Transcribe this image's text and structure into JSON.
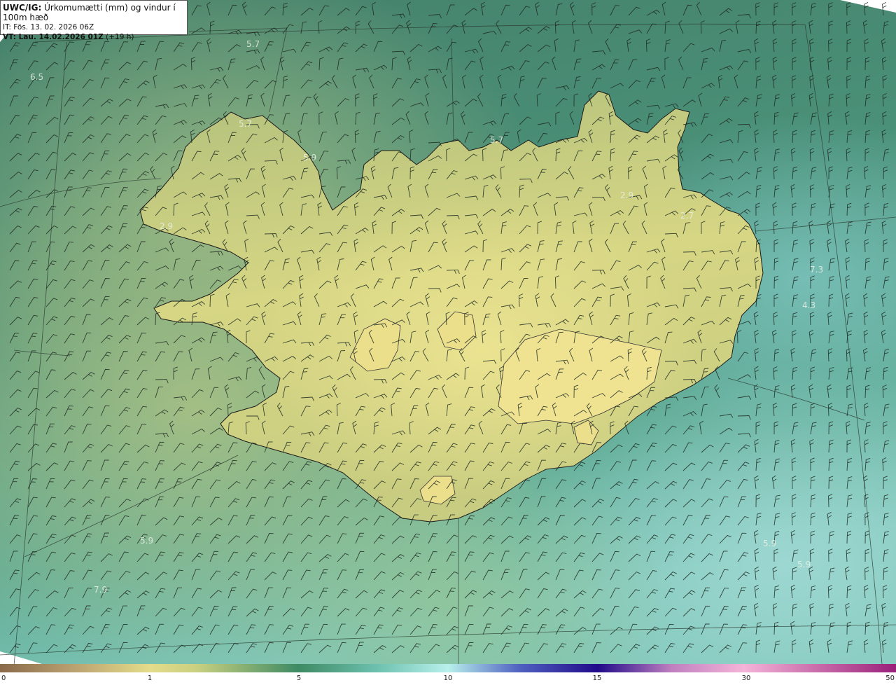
{
  "header": {
    "product": "UWC/IG:",
    "description": " Úrkomumætti (mm) og vindur í 100m hæð",
    "init_time": "IT: Fös. 13. 02. 2026 06Z",
    "valid_prefix": "VT: Lau. 14.02.2026 01Z",
    "valid_suffix": " (+19 h)"
  },
  "map_labels": [
    "5.7",
    "6.5",
    "5.7",
    "5.9",
    "5.7",
    "2.9",
    "2.7",
    "2.9",
    "7.3",
    "4.3",
    "5.9",
    "7.9",
    "5.9",
    "5.9"
  ],
  "colorbar": {
    "ticks": [
      "0",
      "1",
      "5",
      "10",
      "15",
      "30",
      "50"
    ]
  },
  "colors": {
    "land_low": "#c8c878",
    "land_high": "#e6e08c",
    "sea_green": "#4e8a6a",
    "sea_teal": "#6cb8a8",
    "coast": "#1a1a1a"
  }
}
